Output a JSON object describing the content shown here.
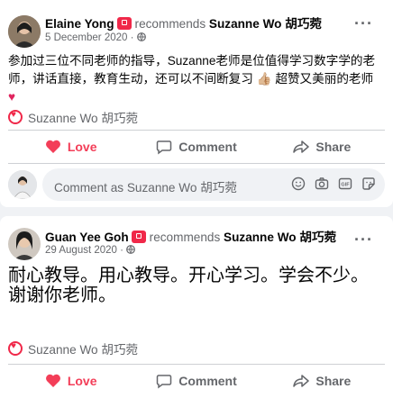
{
  "post1": {
    "author": "Elaine Yong",
    "action": "recommends",
    "page": "Suzanne Wo 胡巧菀",
    "date": "5 December 2020 ·",
    "text": "参加过三位不同老师的指导，Suzanne老师是位值得学习数字学的老师，讲话直接，教育生动，还可以不间断复习",
    "text_end": "超赞又美丽的老师",
    "thumb_emoji": "👍🏼",
    "heart_emoji": "♥",
    "recommends_line": "Suzanne Wo 胡巧菀",
    "love_label": "Love",
    "comment_label": "Comment",
    "share_label": "Share",
    "comment_placeholder": "Comment as Suzanne Wo 胡巧菀"
  },
  "post2": {
    "author": "Guan Yee Goh",
    "action": "recommends",
    "page": "Suzanne Wo 胡巧菀",
    "date": "29 August 2020 ·",
    "text_line1": "耐心教导。用心教导。开心学习。学会不少。",
    "text_line2": "谢谢你老师。",
    "recommends_line": "Suzanne Wo 胡巧菀",
    "love_label": "Love",
    "comment_label": "Comment",
    "share_label": "Share"
  },
  "colors": {
    "love": "#f33e58",
    "badge": "#f02849",
    "muted": "#65676b",
    "bg": "#f0f2f5"
  }
}
